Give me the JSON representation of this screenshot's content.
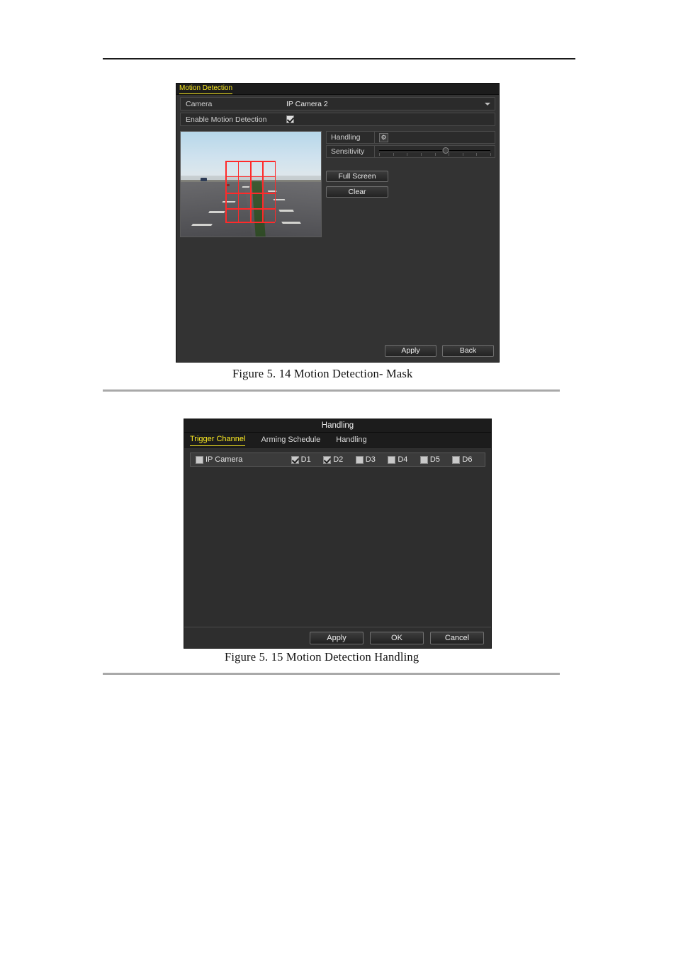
{
  "page": {
    "captions": {
      "figure_514": "Figure 5. 14 Motion Detection- Mask",
      "figure_515": "Figure 5. 15 Motion Detection Handling"
    }
  },
  "motion_detection_dialog": {
    "title": "Motion Detection",
    "rows": [
      {
        "label": "Camera",
        "value": "IP Camera 2",
        "type": "dropdown"
      },
      {
        "label": "Enable Motion Detection",
        "value": "",
        "type": "checkbox",
        "checked": true
      }
    ],
    "controls": {
      "handling_label": "Handling",
      "handling_icon": "gear-icon",
      "sensitivity_label": "Sensitivity",
      "sensitivity_value": 60
    },
    "buttons": {
      "full_screen": "Full Screen",
      "clear": "Clear",
      "apply": "Apply",
      "back": "Back"
    },
    "preview": {
      "scene": "highway-camera-preview",
      "mask_color": "#ff2a2a"
    }
  },
  "handling_dialog": {
    "title": "Handling",
    "tabs": [
      {
        "label": "Trigger Channel",
        "active": true
      },
      {
        "label": "Arming Schedule",
        "active": false
      },
      {
        "label": "Handling",
        "active": false
      }
    ],
    "channel_row": {
      "group_label": "IP Camera",
      "group_checked": false,
      "channels": [
        {
          "label": "D1",
          "checked": true
        },
        {
          "label": "D2",
          "checked": true
        },
        {
          "label": "D3",
          "checked": false
        },
        {
          "label": "D4",
          "checked": false
        },
        {
          "label": "D5",
          "checked": false
        },
        {
          "label": "D6",
          "checked": false
        }
      ]
    },
    "buttons": {
      "apply": "Apply",
      "ok": "OK",
      "cancel": "Cancel"
    }
  },
  "colors": {
    "accent_yellow": "#ffee22",
    "dialog_bg": "#333333",
    "titlebar_bg": "#1c1c1c"
  }
}
